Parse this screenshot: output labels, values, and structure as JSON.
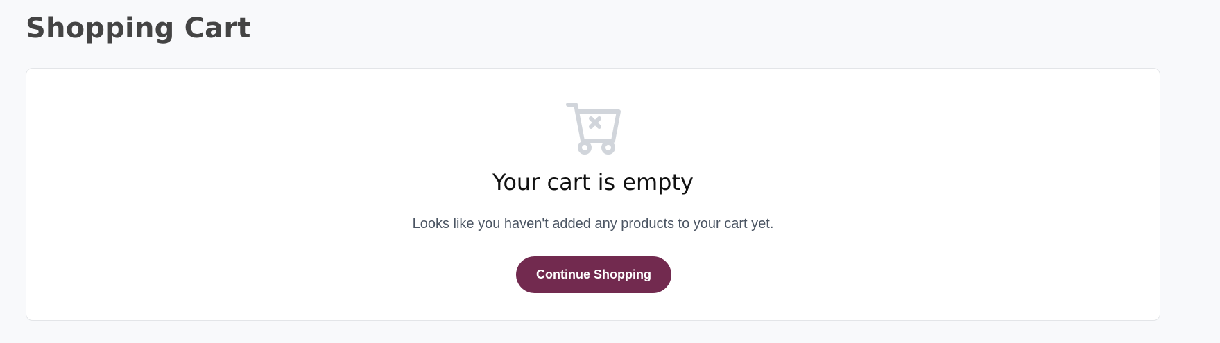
{
  "page": {
    "title": "Shopping Cart"
  },
  "empty_state": {
    "icon": "cart-x-icon",
    "heading": "Your cart is empty",
    "message": "Looks like you haven't added any products to your cart yet.",
    "button_label": "Continue Shopping"
  },
  "colors": {
    "accent": "#722a4f",
    "icon": "#d1d5db",
    "background": "#f8f9fb"
  }
}
